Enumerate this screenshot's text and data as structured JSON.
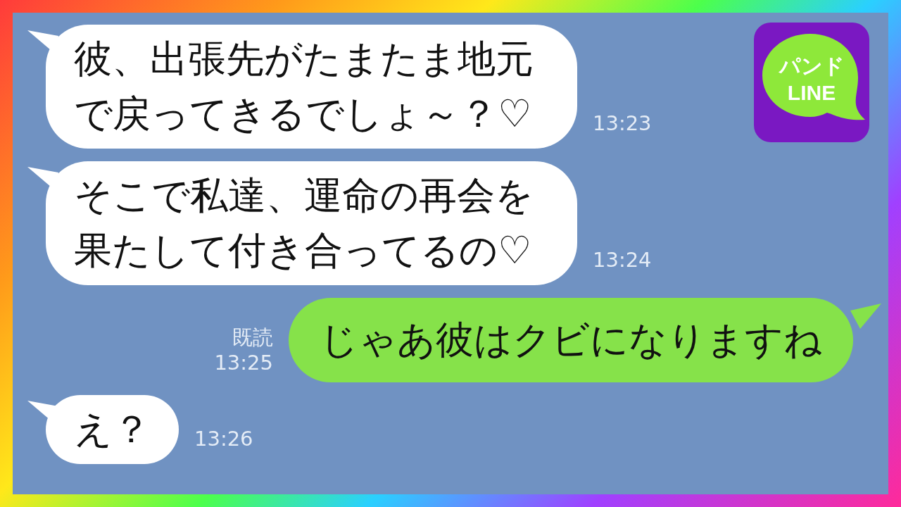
{
  "logo": {
    "lines": [
      "パンド",
      "LINE"
    ]
  },
  "messages": [
    {
      "kind": "received",
      "text": "彼、出張先がたまたま地元で戻ってきるでしょ～？♡",
      "time": "13:23"
    },
    {
      "kind": "received",
      "text": "そこで私達、運命の再会を果たして付き合ってるの♡",
      "time": "13:24"
    },
    {
      "kind": "sent",
      "text": "じゃあ彼はクビになりますね",
      "read": "既読",
      "time": "13:25"
    },
    {
      "kind": "received",
      "text": "え？",
      "time": "13:26"
    }
  ]
}
